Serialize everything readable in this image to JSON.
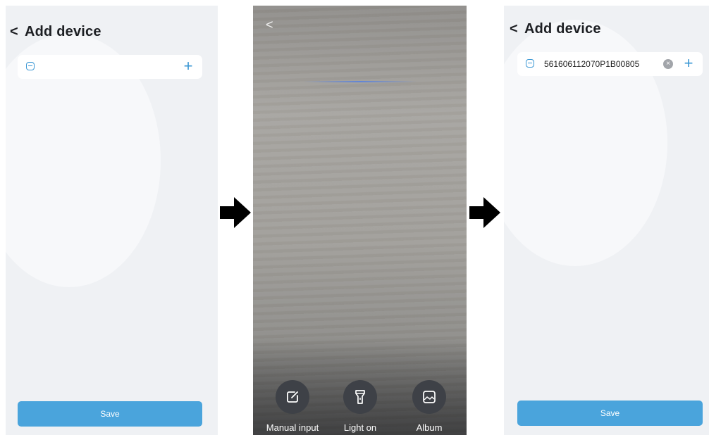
{
  "screens": {
    "before": {
      "title": "Add device",
      "save_label": "Save"
    },
    "scanner": {
      "controls": [
        {
          "label": "Manual input",
          "icon": "edit-icon"
        },
        {
          "label": "Light on",
          "icon": "flashlight-icon"
        },
        {
          "label": "Album",
          "icon": "image-icon"
        }
      ]
    },
    "after": {
      "title": "Add device",
      "serial_value": "561606112070P1B00805",
      "save_label": "Save"
    }
  },
  "colors": {
    "accent": "#3a97d4",
    "save_button": "#4aa4dc",
    "panel_bg": "#eff1f4"
  }
}
